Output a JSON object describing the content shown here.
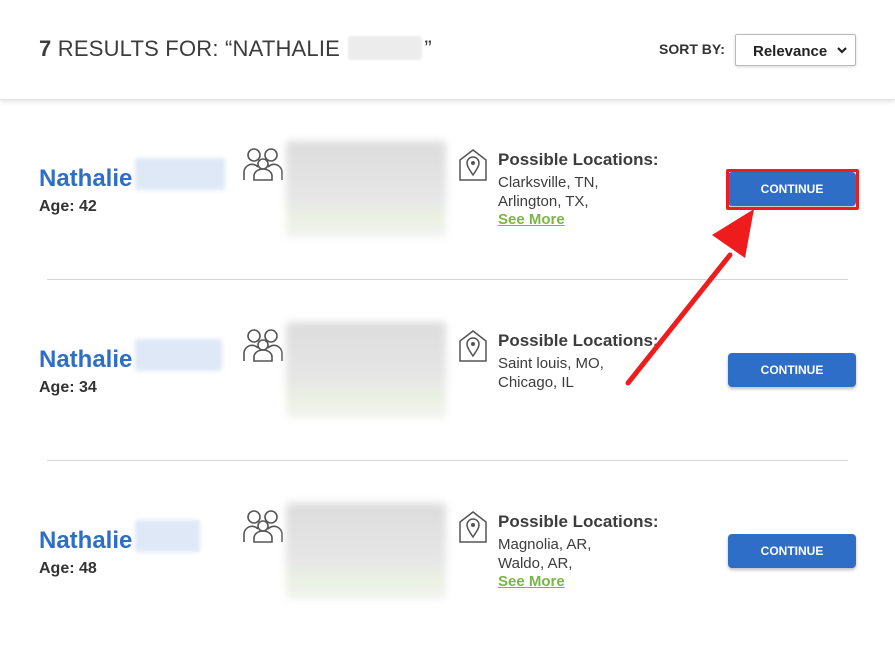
{
  "header": {
    "count": "7",
    "results_for": "RESULTS FOR: “NATHALIE",
    "close_quote": "”",
    "sort_label": "SORT BY:",
    "sort_value": "Relevance"
  },
  "results": [
    {
      "name": "Nathalie",
      "age": "Age: 42",
      "locations_title": "Possible Locations:",
      "locations": [
        "Clarksville, TN,",
        "Arlington, TX,"
      ],
      "see_more": "See More",
      "button": "CONTINUE"
    },
    {
      "name": "Nathalie",
      "age": "Age: 34",
      "locations_title": "Possible Locations:",
      "locations": [
        "Saint louis, MO,",
        "Chicago, IL"
      ],
      "button": "CONTINUE"
    },
    {
      "name": "Nathalie",
      "age": "Age: 48",
      "locations_title": "Possible Locations:",
      "locations": [
        "Magnolia, AR,",
        "Waldo, AR,"
      ],
      "see_more": "See More",
      "button": "CONTINUE"
    }
  ],
  "colors": {
    "accent_blue": "#2f6ec7",
    "link_green": "#7ab548",
    "annotation_red": "#ee1c1c"
  },
  "icons": [
    "relatives-icon",
    "location-pin-icon",
    "chevron-down-icon"
  ]
}
